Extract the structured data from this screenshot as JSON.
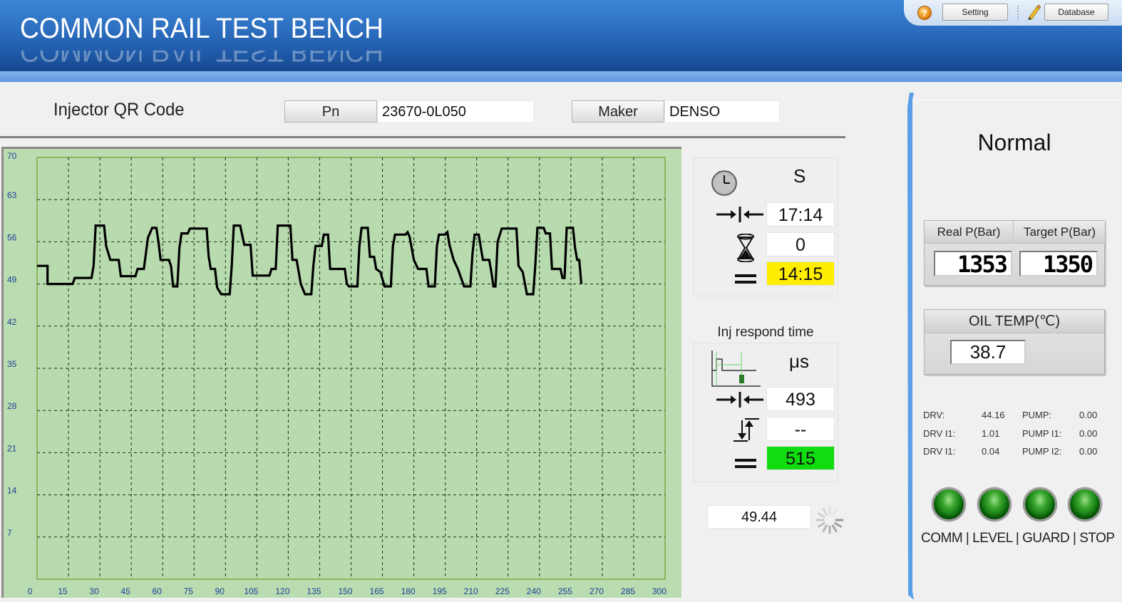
{
  "header": {
    "title": "COMMON RAIL TEST BENCH",
    "help_icon": "help-icon",
    "setting_label": "Setting",
    "pencil_icon": "pencil-icon",
    "database_label": "Database"
  },
  "qr": {
    "label": "Injector QR Code",
    "pn_label": "Pn",
    "pn_value": "23670-0L050",
    "maker_label": "Maker",
    "maker_value": "DENSO"
  },
  "time_panel": {
    "clock_icon": "clock-icon",
    "unit": "S",
    "rows": [
      {
        "icon": "converge-arrows-icon",
        "value": "17:14"
      },
      {
        "icon": "hourglass-icon",
        "value": "0"
      },
      {
        "icon": "equals-icon",
        "value": "14:15",
        "highlight": "#ffee00"
      }
    ]
  },
  "resp_panel": {
    "title": "Inj respond time",
    "waveform_icon": "injector-waveform-icon",
    "unit": "μs",
    "rows": [
      {
        "icon": "converge-arrows-icon",
        "value": "493"
      },
      {
        "icon": "vertical-arrows-icon",
        "value": "--"
      },
      {
        "icon": "equals-icon",
        "value": "515",
        "highlight": "#10dd10"
      }
    ]
  },
  "bottom_value": "49.44",
  "spinner_icon": "loading-spinner-icon",
  "right_panel": {
    "status": "Normal",
    "real_p_label": "Real P(Bar)",
    "target_p_label": "Target P(Bar)",
    "real_p_value": "1353",
    "target_p_value": "1350",
    "oil_temp_label": "OIL TEMP(℃)",
    "oil_temp_value": "38.7",
    "stats": [
      {
        "l1": "DRV:",
        "v1": "44.16",
        "l2": "PUMP:",
        "v2": "0.00"
      },
      {
        "l1": "DRV I1:",
        "v1": "1.01",
        "l2": "PUMP I1:",
        "v2": "0.00"
      },
      {
        "l1": "DRV I1:",
        "v1": "0.04",
        "l2": "PUMP I2:",
        "v2": "0.00"
      }
    ],
    "leds": [
      {
        "name": "COMM",
        "color": "#1a8a1a"
      },
      {
        "name": "LEVEL",
        "color": "#1a8a1a"
      },
      {
        "name": "GUARD",
        "color": "#1a8a1a"
      },
      {
        "name": "STOP",
        "color": "#1a8a1a"
      }
    ],
    "led_labels": "COMM | LEVEL | GUARD | STOP"
  },
  "colors": {
    "header_blue": "#2d6fc0",
    "plot_bg": "#b9dcb0",
    "axis_label": "#1f3f99",
    "trace": "#000000",
    "highlight_yellow": "#ffee00",
    "highlight_green": "#10dd10"
  },
  "chart_data": {
    "type": "line",
    "title": "",
    "xlabel": "",
    "ylabel": "",
    "xlim": [
      0,
      300
    ],
    "ylim": [
      0,
      70
    ],
    "x_ticks": [
      0,
      15,
      30,
      45,
      60,
      75,
      90,
      105,
      120,
      135,
      150,
      165,
      180,
      195,
      210,
      225,
      240,
      255,
      270,
      285,
      300
    ],
    "y_ticks": [
      7,
      14,
      21,
      28,
      35,
      42,
      49,
      56,
      63,
      70
    ],
    "grid": true,
    "legend": "none",
    "series": [
      {
        "name": "trace",
        "step": true,
        "points": [
          [
            0,
            52
          ],
          [
            5,
            52
          ],
          [
            5,
            49
          ],
          [
            17,
            49
          ],
          [
            18,
            50
          ],
          [
            26,
            50
          ],
          [
            27,
            52
          ],
          [
            28,
            58.7
          ],
          [
            32,
            58.7
          ],
          [
            33,
            55.3
          ],
          [
            35,
            53
          ],
          [
            39,
            53
          ],
          [
            40,
            50.3
          ],
          [
            47,
            50.3
          ],
          [
            48,
            51.5
          ],
          [
            51,
            51.5
          ],
          [
            53,
            56.7
          ],
          [
            55,
            58.3
          ],
          [
            57,
            58.3
          ],
          [
            58,
            56
          ],
          [
            59,
            53
          ],
          [
            63,
            53
          ],
          [
            64,
            52
          ],
          [
            65,
            48.6
          ],
          [
            67,
            48.6
          ],
          [
            68,
            55
          ],
          [
            69,
            57.4
          ],
          [
            72,
            57.4
          ],
          [
            73,
            58.2
          ],
          [
            81,
            58.2
          ],
          [
            82,
            53.5
          ],
          [
            83,
            51.5
          ],
          [
            85,
            51.5
          ],
          [
            86,
            48.4
          ],
          [
            88,
            47.3
          ],
          [
            92,
            47.3
          ],
          [
            93,
            52
          ],
          [
            94,
            58.7
          ],
          [
            97,
            58.7
          ],
          [
            99,
            55.5
          ],
          [
            102,
            55.5
          ],
          [
            103,
            50.4
          ],
          [
            111,
            50.4
          ],
          [
            112,
            51.5
          ],
          [
            114,
            51.5
          ],
          [
            115,
            58.7
          ],
          [
            121,
            58.7
          ],
          [
            122,
            53
          ],
          [
            124,
            53
          ],
          [
            126,
            49
          ],
          [
            128,
            47.3
          ],
          [
            131,
            47.3
          ],
          [
            132,
            52
          ],
          [
            133,
            55.3
          ],
          [
            136,
            55.3
          ],
          [
            137,
            57.2
          ],
          [
            139,
            57.2
          ],
          [
            140,
            51.5
          ],
          [
            147,
            51.5
          ],
          [
            148,
            49
          ],
          [
            149,
            48.6
          ],
          [
            153,
            48.6
          ],
          [
            154,
            55.3
          ],
          [
            155,
            58.3
          ],
          [
            158,
            58.3
          ],
          [
            159,
            53.5
          ],
          [
            161,
            53.5
          ],
          [
            162,
            51.5
          ],
          [
            164,
            51
          ],
          [
            166,
            48.6
          ],
          [
            169,
            48.6
          ],
          [
            170,
            55.3
          ],
          [
            171,
            57.2
          ],
          [
            176,
            57.2
          ],
          [
            177,
            57.6
          ],
          [
            178,
            56.8
          ],
          [
            180,
            53
          ],
          [
            182,
            51.5
          ],
          [
            186,
            51.5
          ],
          [
            187,
            48.6
          ],
          [
            190,
            48.6
          ],
          [
            191,
            55.3
          ],
          [
            192,
            57.2
          ],
          [
            195,
            57.2
          ],
          [
            196,
            57.6
          ],
          [
            197,
            55.5
          ],
          [
            199,
            53
          ],
          [
            201,
            51.5
          ],
          [
            204,
            48.6
          ],
          [
            207,
            48.6
          ],
          [
            208,
            54
          ],
          [
            209,
            57.2
          ],
          [
            211,
            57.2
          ],
          [
            212,
            55
          ],
          [
            213,
            53
          ],
          [
            216,
            53
          ],
          [
            217,
            51
          ],
          [
            218,
            48.6
          ],
          [
            219,
            48.6
          ],
          [
            220,
            56
          ],
          [
            222,
            58.2
          ],
          [
            229,
            58.2
          ],
          [
            230,
            52
          ],
          [
            232,
            51
          ],
          [
            234,
            47.3
          ],
          [
            237,
            47.3
          ],
          [
            238,
            52
          ],
          [
            239,
            58.3
          ],
          [
            242,
            58.3
          ],
          [
            243,
            57.4
          ],
          [
            245,
            57.4
          ],
          [
            246,
            51.5
          ],
          [
            250,
            51.5
          ],
          [
            251,
            50
          ],
          [
            252,
            50
          ],
          [
            253,
            58.3
          ],
          [
            256,
            58.3
          ],
          [
            257,
            55
          ],
          [
            258,
            53
          ],
          [
            259,
            53
          ],
          [
            260,
            49
          ]
        ]
      }
    ]
  }
}
